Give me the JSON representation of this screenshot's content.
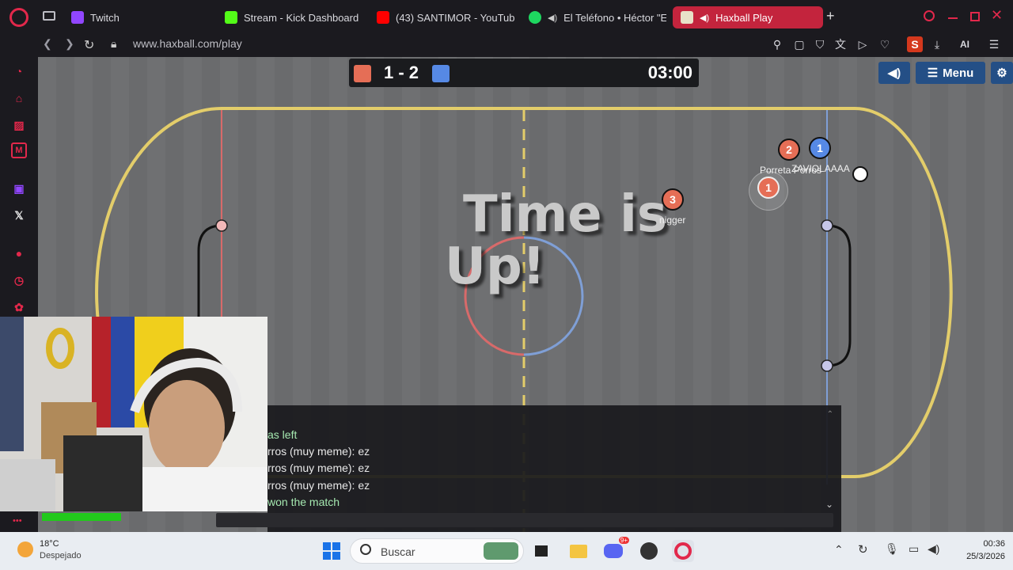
{
  "browser": {
    "tabs": [
      {
        "label": "Twitch",
        "color": "#9146ff",
        "icon": "twitch-icon"
      },
      {
        "label": "Stream - Kick Dashboard",
        "color": "#53fc18",
        "icon": "kick-icon"
      },
      {
        "label": "(43) SANTIMOR - YouTube",
        "color": "#ff0000",
        "icon": "youtube-icon"
      },
      {
        "label": "El Teléfono • Héctor \"El",
        "color": "#1ed760",
        "icon": "spotify-icon"
      },
      {
        "label": "Haxball Play",
        "color": "#c3243d",
        "icon": "haxball-icon"
      }
    ],
    "new_tab": "+",
    "url": "www.haxball.com/play",
    "ai_label": "AI",
    "profile_initial": "S"
  },
  "scoreboard": {
    "score": "1 - 2",
    "time": "03:00",
    "red_color": "#e56e56",
    "blue_color": "#5689e5",
    "menu_label": "Menu"
  },
  "overlay": {
    "line1": "Time is",
    "line2": "Up!"
  },
  "players": [
    {
      "number": "3",
      "name": "nigger",
      "team": "red"
    },
    {
      "number": "2",
      "name": "Porreta Porros",
      "team": "red"
    },
    {
      "number": "1",
      "name": "ZAVIOLAAAA",
      "team": "blue"
    },
    {
      "number": "1",
      "name": "",
      "team": "red"
    }
  ],
  "chat": {
    "lines": [
      {
        "text": "as left",
        "color": "green"
      },
      {
        "text": "rros (muy meme): ez",
        "color": "white"
      },
      {
        "text": "rros (muy meme): ez",
        "color": "white"
      },
      {
        "text": "rros (muy meme): ez",
        "color": "white"
      },
      {
        "text": " won the match",
        "color": "green"
      }
    ]
  },
  "taskbar": {
    "temperature": "18°C",
    "weather": "Despejado",
    "search_placeholder": "Buscar",
    "time": "00:36",
    "date": "25/3/2026",
    "discord_badge": "9+"
  }
}
